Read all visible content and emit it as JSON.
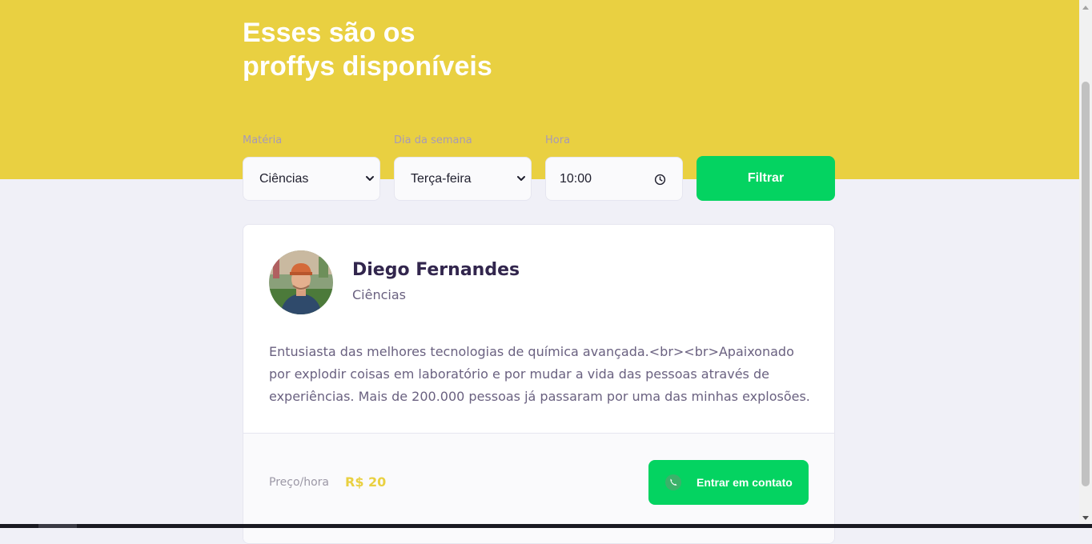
{
  "header": {
    "title_line1": "Esses são os",
    "title_line2": "proffys disponíveis"
  },
  "filters": {
    "subject": {
      "label": "Matéria",
      "value": "Ciências"
    },
    "weekday": {
      "label": "Dia da semana",
      "value": "Terça-feira"
    },
    "time": {
      "label": "Hora",
      "value": "10:00"
    },
    "submit_label": "Filtrar"
  },
  "teacher": {
    "name": "Diego Fernandes",
    "subject": "Ciências",
    "bio": "Entusiasta das melhores tecnologias de química avançada.<br><br>Apaixonado por explodir coisas em laboratório e por mudar a vida das pessoas através de experiências. Mais de 200.000 pessoas já passaram por uma das minhas explosões.",
    "price_label": "Preço/hora",
    "price_value": "R$ 20",
    "contact_label": "Entrar em contato"
  },
  "colors": {
    "hero": "#e9d041",
    "accent_green": "#04d361",
    "page_background": "#f0f0f7",
    "title_text": "#32264d"
  },
  "icons": {
    "select_arrow": "chevron-down-icon",
    "time_picker": "clock-icon",
    "contact": "whatsapp-icon"
  }
}
